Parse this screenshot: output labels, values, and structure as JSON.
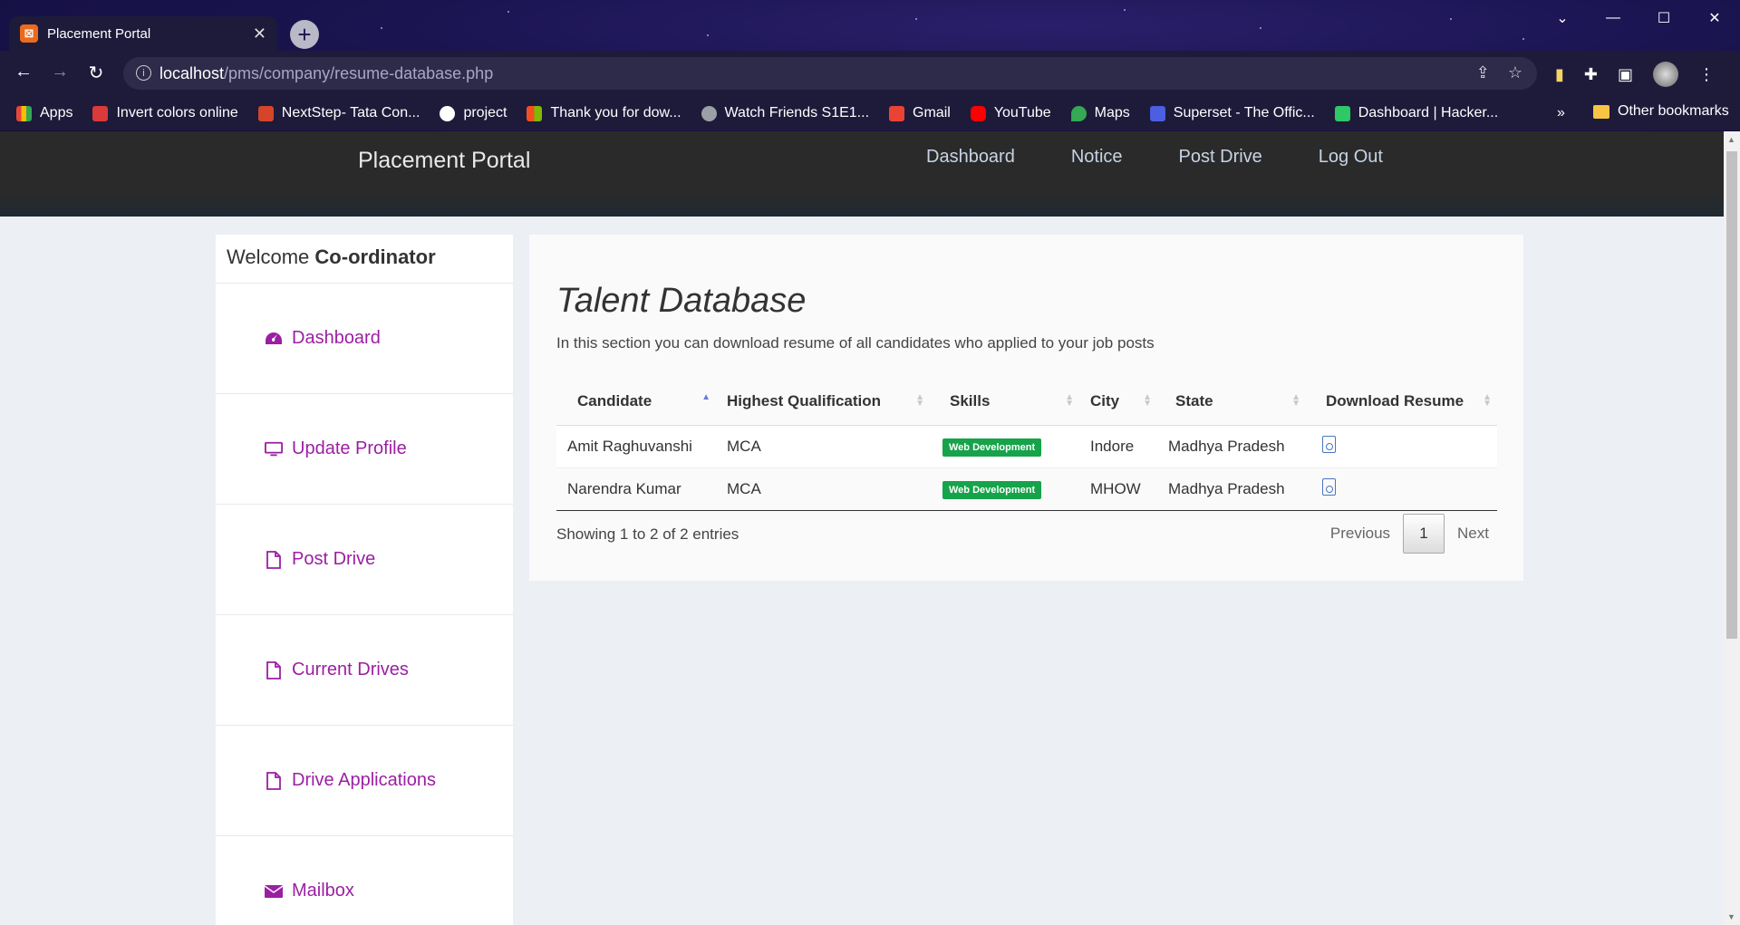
{
  "browser": {
    "tab_title": "Placement Portal",
    "favicon_label": "⊠",
    "url_host": "localhost",
    "url_path": "/pms/company/resume-database.php",
    "bookmarks": [
      {
        "label": "Apps",
        "color": "#e8453c"
      },
      {
        "label": "Invert colors online",
        "color": "#d93a3a"
      },
      {
        "label": "NextStep- Tata Con...",
        "color": "#d4452c"
      },
      {
        "label": "project",
        "color": "#ffffff"
      },
      {
        "label": "Thank you for dow...",
        "color": "#2f8ce6"
      },
      {
        "label": "Watch Friends S1E1...",
        "color": "#9aa0a6"
      },
      {
        "label": "Gmail",
        "color": "#ea4335"
      },
      {
        "label": "YouTube",
        "color": "#ff0000"
      },
      {
        "label": "Maps",
        "color": "#34a853"
      },
      {
        "label": "Superset - The Offic...",
        "color": "#4b5fe0"
      },
      {
        "label": "Dashboard | Hacker...",
        "color": "#2ec866"
      }
    ],
    "bookmarks_more": "»",
    "other_bookmarks": "Other bookmarks"
  },
  "navbar": {
    "brand": "Placement Portal",
    "links": [
      "Dashboard",
      "Notice",
      "Post Drive",
      "Log Out"
    ]
  },
  "sidebar": {
    "welcome_prefix": "Welcome",
    "welcome_name": "Co-ordinator",
    "items": [
      {
        "label": "Dashboard",
        "icon": "dashboard-icon"
      },
      {
        "label": "Update Profile",
        "icon": "monitor-icon"
      },
      {
        "label": "Post Drive",
        "icon": "file-icon"
      },
      {
        "label": "Current Drives",
        "icon": "file-icon"
      },
      {
        "label": "Drive Applications",
        "icon": "file-icon"
      },
      {
        "label": "Mailbox",
        "icon": "envelope-icon"
      }
    ]
  },
  "main": {
    "title": "Talent Database",
    "description": "In this section you can download resume of all candidates who applied to your job posts",
    "columns": [
      "Candidate",
      "Highest Qualification",
      "Skills",
      "City",
      "State",
      "Download Resume"
    ],
    "rows": [
      {
        "candidate": "Amit Raghuvanshi",
        "qualification": "MCA",
        "skills": "Web Development",
        "city": "Indore",
        "state": "Madhya Pradesh"
      },
      {
        "candidate": "Narendra Kumar",
        "qualification": "MCA",
        "skills": "Web Development",
        "city": "MHOW",
        "state": "Madhya Pradesh"
      }
    ],
    "entries_info": "Showing 1 to 2 of 2 entries",
    "pager": {
      "previous": "Previous",
      "current": "1",
      "next": "Next"
    }
  },
  "colors": {
    "accent": "#9b1fa3",
    "badge": "#16a34a",
    "navbar": "#2a2a2a"
  }
}
